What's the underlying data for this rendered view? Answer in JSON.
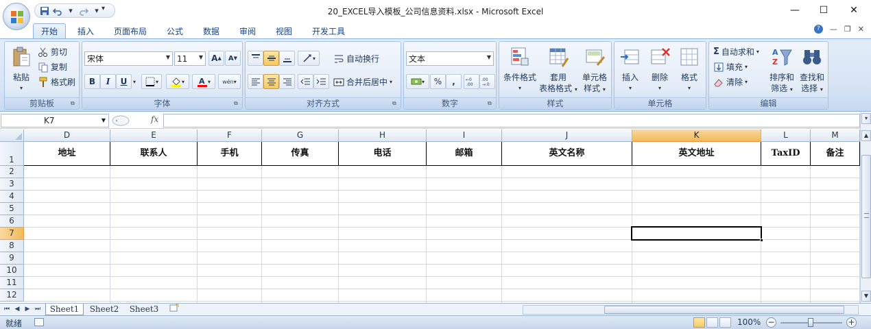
{
  "window": {
    "title": "20_EXCEL导入模板_公司信息资料.xlsx - Microsoft Excel",
    "minimize": "—",
    "maximize": "☐",
    "close": "✕"
  },
  "quick_access": {
    "icons": [
      "save-icon",
      "undo-icon",
      "redo-icon",
      "customize-icon"
    ]
  },
  "tabs": [
    {
      "label": "开始",
      "active": true
    },
    {
      "label": "插入"
    },
    {
      "label": "页面布局"
    },
    {
      "label": "公式"
    },
    {
      "label": "数据"
    },
    {
      "label": "审阅"
    },
    {
      "label": "视图"
    },
    {
      "label": "开发工具"
    }
  ],
  "ribbon": {
    "clipboard": {
      "label": "剪贴板",
      "paste": "粘贴",
      "cut": "剪切",
      "copy": "复制",
      "format_painter": "格式刷"
    },
    "font": {
      "label": "字体",
      "font_name": "宋体",
      "font_size": "11",
      "grow": "A",
      "shrink": "A",
      "bold": "B",
      "italic": "I",
      "underline": "U",
      "phonetic": "wén"
    },
    "alignment": {
      "label": "对齐方式",
      "wrap_text": "自动换行",
      "merge_center": "合并后居中"
    },
    "number": {
      "label": "数字",
      "format": "文本",
      "percent": "%",
      "comma": ","
    },
    "styles": {
      "label": "样式",
      "conditional_formatting": "条件格式",
      "format_as_table_line1": "套用",
      "format_as_table_line2": "表格格式",
      "cell_styles_line1": "单元格",
      "cell_styles_line2": "样式"
    },
    "cells": {
      "label": "单元格",
      "insert": "插入",
      "delete": "删除",
      "format": "格式"
    },
    "editing": {
      "label": "编辑",
      "autosum": "自动求和",
      "fill": "填充",
      "clear": "清除",
      "sort_filter_line1": "排序和",
      "sort_filter_line2": "筛选",
      "find_select_line1": "查找和",
      "find_select_line2": "选择"
    }
  },
  "formula_bar": {
    "name_box": "K7",
    "fx": "fx",
    "formula": ""
  },
  "sheet": {
    "columns": [
      "D",
      "E",
      "F",
      "G",
      "H",
      "I",
      "J",
      "K",
      "L",
      "M"
    ],
    "selected_column": "K",
    "rows": [
      "1",
      "2",
      "3",
      "4",
      "5",
      "6",
      "7",
      "8",
      "9",
      "10",
      "11",
      "12"
    ],
    "selected_row": "7",
    "active_cell": "K7",
    "header_cells": [
      "地址",
      "联系人",
      "手机",
      "传真",
      "电话",
      "邮箱",
      "英文名称",
      "英文地址",
      "TaxID",
      "备注"
    ]
  },
  "sheet_tabs": [
    {
      "label": "Sheet1",
      "active": true
    },
    {
      "label": "Sheet2"
    },
    {
      "label": "Sheet3"
    }
  ],
  "status_bar": {
    "status": "就绪",
    "zoom": "100%",
    "zoom_minus": "−",
    "zoom_plus": "+"
  },
  "colors": {
    "ribbon_bg": "#d7e4f5",
    "tab_text": "#15428b",
    "selected_header": "#f1b95b",
    "gridline": "#d0d7e5"
  }
}
